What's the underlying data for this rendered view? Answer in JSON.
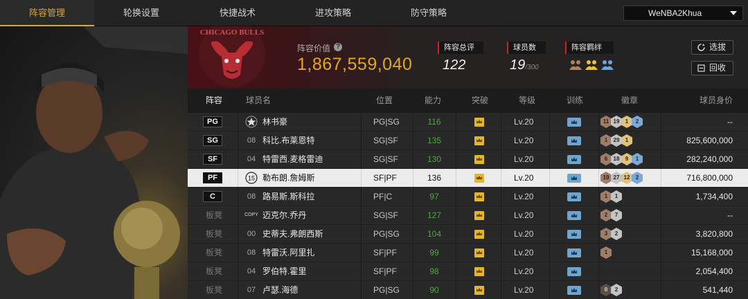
{
  "nav": {
    "tabs": [
      {
        "label": "阵容管理",
        "active": true
      },
      {
        "label": "轮换设置",
        "active": false
      },
      {
        "label": "快捷战术",
        "active": false
      },
      {
        "label": "进攻策略",
        "active": false
      },
      {
        "label": "防守策略",
        "active": false
      }
    ],
    "account": "WeNBA2Khua"
  },
  "header": {
    "team_logo_text": "CHICAGO BULLS",
    "value_label": "阵容价值",
    "value": "1,867,559,040",
    "overall_label": "阵容总评",
    "overall_value": "122",
    "players_label": "球员数",
    "players_value": "19",
    "players_max": "/300",
    "bond_label": "阵容羁绊",
    "select_button": "选拔",
    "recycle_button": "回收"
  },
  "table": {
    "headers": [
      "阵容",
      "球员名",
      "位置",
      "能力",
      "突破",
      "等级",
      "训练",
      "徽章",
      "球员身价"
    ],
    "rows": [
      {
        "slot": "PG",
        "bench": false,
        "jersey": "",
        "jersey_icon": "star",
        "name": "林书豪",
        "position": "PG|SG",
        "ability": "116",
        "level": "Lv.20",
        "badges": [
          [
            "bronze",
            "11"
          ],
          [
            "silver",
            "19"
          ],
          [
            "gold",
            "1"
          ],
          [
            "blue",
            "2"
          ]
        ],
        "price": "--",
        "selected": false
      },
      {
        "slot": "SG",
        "bench": false,
        "jersey": "08",
        "name": "科比.布莱恩特",
        "position": "SG|SF",
        "ability": "135",
        "level": "Lv.20",
        "badges": [
          [
            "bronze",
            "1"
          ],
          [
            "silver",
            "29"
          ],
          [
            "gold",
            "1"
          ]
        ],
        "price": "825,600,000",
        "selected": false
      },
      {
        "slot": "SF",
        "bench": false,
        "jersey": "04",
        "name": "特雷西.麦格雷迪",
        "position": "SG|SF",
        "ability": "130",
        "level": "Lv.20",
        "badges": [
          [
            "bronze",
            "6"
          ],
          [
            "silver",
            "18"
          ],
          [
            "gold",
            "9"
          ],
          [
            "blue",
            "1"
          ]
        ],
        "price": "282,240,000",
        "selected": false
      },
      {
        "slot": "PF",
        "bench": false,
        "jersey": "15",
        "jersey_icon": "circle",
        "name": "勒布朗.詹姆斯",
        "position": "SF|PF",
        "ability": "136",
        "level": "Lv.20",
        "badges": [
          [
            "bronze",
            "19"
          ],
          [
            "silver",
            "27"
          ],
          [
            "gold",
            "12"
          ],
          [
            "blue",
            "2"
          ]
        ],
        "price": "716,800,000",
        "selected": true
      },
      {
        "slot": "C",
        "bench": false,
        "jersey": "08",
        "name": "路易斯.斯科拉",
        "position": "PF|C",
        "ability": "97",
        "level": "Lv.20",
        "badges": [
          [
            "bronze",
            "1"
          ],
          [
            "silver",
            "1"
          ]
        ],
        "price": "1,734,400",
        "selected": false
      },
      {
        "slot": "板凳",
        "bench": true,
        "jersey": "COPY",
        "name": "迈克尔.乔丹",
        "position": "SG|SF",
        "ability": "127",
        "level": "Lv.20",
        "badges": [
          [
            "bronze",
            "2"
          ],
          [
            "silver",
            "7"
          ]
        ],
        "price": "--",
        "selected": false
      },
      {
        "slot": "板凳",
        "bench": true,
        "jersey": "00",
        "name": "史蒂夫.弗朗西斯",
        "position": "PG|SG",
        "ability": "104",
        "level": "Lv.20",
        "badges": [
          [
            "bronze",
            "3"
          ],
          [
            "silver",
            "2"
          ]
        ],
        "price": "3,820,800",
        "selected": false
      },
      {
        "slot": "板凳",
        "bench": true,
        "jersey": "08",
        "name": "特雷沃.阿里扎",
        "position": "SF|PF",
        "ability": "99",
        "level": "Lv.20",
        "badges": [
          [
            "bronze",
            "1"
          ]
        ],
        "price": "15,168,000",
        "selected": false
      },
      {
        "slot": "板凳",
        "bench": true,
        "jersey": "04",
        "name": "罗伯特.霍里",
        "position": "SF|PF",
        "ability": "98",
        "level": "Lv.20",
        "badges": [],
        "price": "2,054,400",
        "selected": false
      },
      {
        "slot": "板凳",
        "bench": true,
        "jersey": "07",
        "name": "卢瑟.海德",
        "position": "PG|SG",
        "ability": "90",
        "level": "Lv.20",
        "badges": [
          [
            "dark",
            "0"
          ],
          [
            "silver",
            "2"
          ]
        ],
        "price": "541,440",
        "selected": false
      }
    ]
  }
}
